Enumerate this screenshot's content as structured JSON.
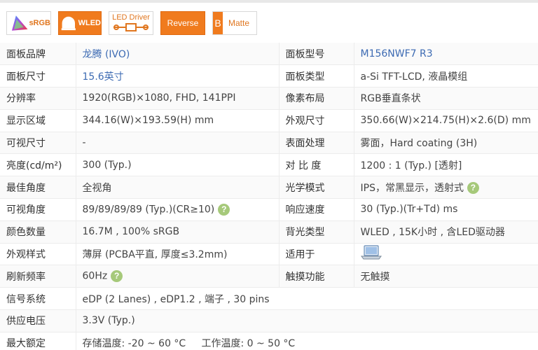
{
  "badges": {
    "srgb": "sRGB",
    "wled": "WLED",
    "led_driver": "LED Driver",
    "reverse": "Reverse",
    "matte_letter": "B",
    "matte": "Matte"
  },
  "rows": [
    {
      "l1": "面板品牌",
      "v1": "龙腾 (IVO)",
      "l2": "面板型号",
      "v2": "M156NWF7 R3"
    },
    {
      "l1": "面板尺寸",
      "v1": "15.6英寸",
      "l2": "面板类型",
      "v2": "a-Si TFT-LCD, 液晶模组"
    },
    {
      "l1": "分辨率",
      "v1": "1920(RGB)×1080, FHD, 141PPI",
      "l2": "像素布局",
      "v2": "RGB垂直条状"
    },
    {
      "l1": "显示区域",
      "v1": "344.16(W)×193.59(H) mm",
      "l2": "外观尺寸",
      "v2": "350.66(W)×214.75(H)×2.6(D) mm"
    },
    {
      "l1": "可视尺寸",
      "v1": "-",
      "l2": "表面处理",
      "v2": "雾面，Hard coating (3H)"
    },
    {
      "l1": "亮度(cd/m²)",
      "v1": "300 (Typ.)",
      "l2": "对 比 度",
      "v2": "1200 : 1 (Typ.) [透射]"
    },
    {
      "l1": "最佳角度",
      "v1": "全视角",
      "l2": "光学模式",
      "v2": "IPS，常黑显示，透射式"
    },
    {
      "l1": "可视角度",
      "v1": "89/89/89/89 (Typ.)(CR≥10)",
      "l2": "响应速度",
      "v2": "30 (Typ.)(Tr+Td) ms"
    },
    {
      "l1": "颜色数量",
      "v1": "16.7M , 100% sRGB",
      "l2": "背光类型",
      "v2": "WLED , 15K小时 , 含LED驱动器"
    },
    {
      "l1": "外观样式",
      "v1": "薄屏 (PCBA平直, 厚度≤3.2mm)",
      "l2": "适用于",
      "v2": ""
    },
    {
      "l1": "刷新频率",
      "v1": "60Hz",
      "l2": "触摸功能",
      "v2": "无触摸"
    },
    {
      "l1": "信号系统",
      "v1": "eDP (2 Lanes) , eDP1.2 , 端子 , 30 pins"
    },
    {
      "l1": "供应电压",
      "v1": "3.3V (Typ.)"
    },
    {
      "l1": "最大额定",
      "v1": "存储温度: -20 ~ 60 °C     工作温度: 0 ~ 50 °C"
    }
  ],
  "help_glyph": "?",
  "colors": {
    "accent": "#f07b1e",
    "link": "#3d6bb3",
    "help": "#a6c97a"
  }
}
